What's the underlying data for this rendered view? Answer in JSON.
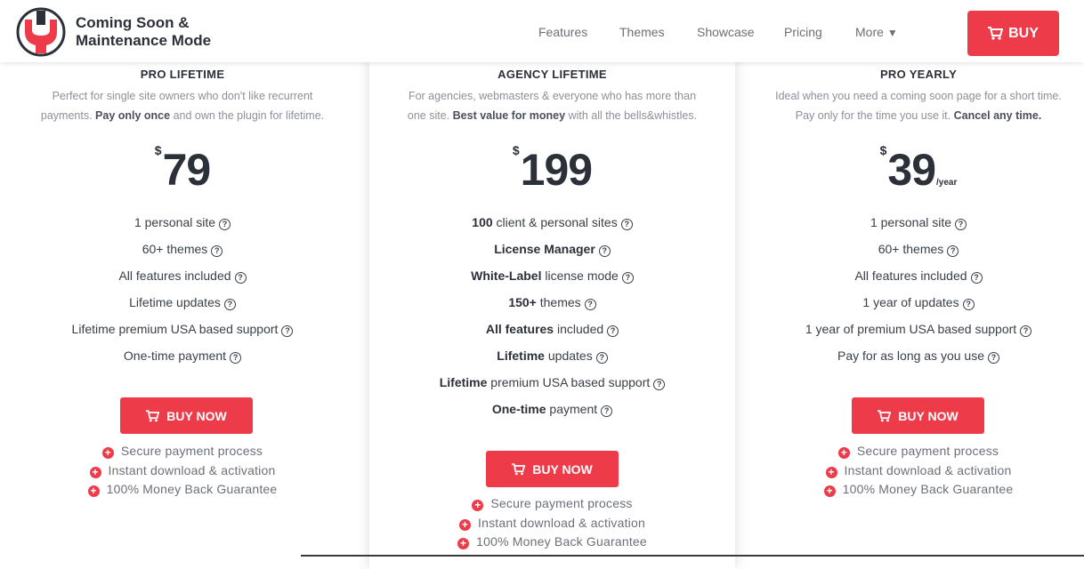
{
  "header": {
    "brand_line1": "Coming Soon &",
    "brand_line2": "Maintenance Mode",
    "nav": [
      {
        "label": "Features"
      },
      {
        "label": "Themes"
      },
      {
        "label": "Showcase"
      },
      {
        "label": "Pricing"
      },
      {
        "label": "More",
        "indicator": "▼"
      }
    ],
    "buy_label": "BUY"
  },
  "plans": [
    {
      "name": "PRO LIFETIME",
      "desc_line1": "Perfect for single site owners who don't like recurrent",
      "desc_line2_pre": "payments.",
      "desc_line2_bold": "Pay only once",
      "desc_line2_post": "and own the plugin for lifetime.",
      "currency": "$",
      "price": "79",
      "period": "",
      "features": [
        {
          "bold": "",
          "text": "1 personal site"
        },
        {
          "bold": "",
          "text": "60+ themes"
        },
        {
          "bold": "",
          "text": "All features included"
        },
        {
          "bold": "",
          "text": "Lifetime updates"
        },
        {
          "bold": "",
          "text": "Lifetime premium USA based support"
        },
        {
          "bold": "",
          "text": "One-time payment"
        }
      ],
      "button": "BUY NOW",
      "perks": [
        "Secure payment process",
        "Instant download & activation",
        "100% Money Back Guarantee"
      ]
    },
    {
      "name": "AGENCY LIFETIME",
      "desc_line1": "For agencies, webmasters & everyone who has more than",
      "desc_line2_pre": "one site.",
      "desc_line2_bold": "Best value for money",
      "desc_line2_post": "with all the bells&whistles.",
      "currency": "$",
      "price": "199",
      "period": "",
      "features": [
        {
          "bold": "100",
          "text": " client & personal sites"
        },
        {
          "bold": "License Manager",
          "text": ""
        },
        {
          "bold": "White-Label",
          "text": " license mode"
        },
        {
          "bold": "150+",
          "text": " themes"
        },
        {
          "bold": "All features",
          "text": " included"
        },
        {
          "bold": "Lifetime",
          "text": " updates"
        },
        {
          "bold": "Lifetime",
          "text": " premium USA based support"
        },
        {
          "bold": "One-time",
          "text": " payment"
        }
      ],
      "button": "BUY NOW",
      "perks": [
        "Secure payment process",
        "Instant download & activation",
        "100% Money Back Guarantee"
      ]
    },
    {
      "name": "PRO YEARLY",
      "desc_line1": "Ideal when you need a coming soon page for a short time.",
      "desc_line2_pre": "Pay only for the time you use it.",
      "desc_line2_bold": "Cancel any time.",
      "desc_line2_post": "",
      "currency": "$",
      "price": "39",
      "period": "/year",
      "features": [
        {
          "bold": "",
          "text": "1 personal site"
        },
        {
          "bold": "",
          "text": "60+ themes"
        },
        {
          "bold": "",
          "text": "All features included"
        },
        {
          "bold": "",
          "text": "1 year of updates"
        },
        {
          "bold": "",
          "text": "1 year of premium USA based support"
        },
        {
          "bold": "",
          "text": "Pay for as long as you use"
        }
      ],
      "button": "BUY NOW",
      "perks": [
        "Secure payment process",
        "Instant download & activation",
        "100% Money Back Guarantee"
      ]
    }
  ],
  "colors": {
    "accent": "#ee3b4a",
    "heading": "#2c3038",
    "muted": "#8b9099"
  },
  "icons": {
    "logo": "wrench-logo-icon",
    "cart": "cart-icon",
    "help": "question-circle-icon",
    "perk": "plus-circle-icon"
  }
}
